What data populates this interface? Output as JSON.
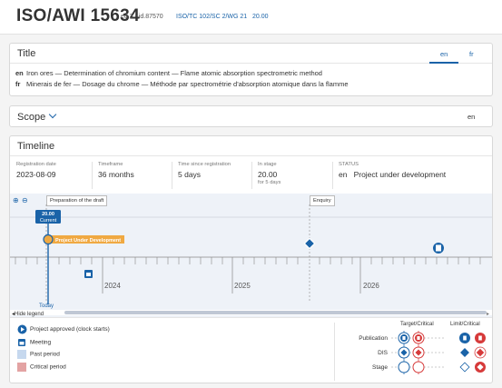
{
  "header": {
    "reference": "ISO/AWI 15634",
    "meta": "ed.3 - id.87570",
    "committee": "ISO/TC 102/SC 2/WG 21",
    "stage": "20.00"
  },
  "title_card": {
    "heading": "Title",
    "tabs": [
      "en",
      "fr"
    ],
    "active_tab": "en",
    "rows": [
      {
        "lang": "en",
        "text": "Iron ores — Determination of chromium content — Flame atomic absorption spectrometric method"
      },
      {
        "lang": "fr",
        "text": "Minerais de fer — Dosage du chrome — Méthode par spectrométrie d'absorption atomique dans la flamme"
      }
    ]
  },
  "scope_card": {
    "heading": "Scope",
    "language": "en"
  },
  "timeline": {
    "heading": "Timeline",
    "stats": [
      {
        "label": "Registration date",
        "value": "2023-08-09",
        "sub": ""
      },
      {
        "label": "Timeframe",
        "value": "36 months",
        "sub": ""
      },
      {
        "label": "Time since registration",
        "value": "5 days",
        "sub": ""
      },
      {
        "label": "In stage",
        "value": "20.00",
        "sub": "for 5 days"
      },
      {
        "label": "STATUS",
        "value": "Project under development",
        "sub": "",
        "lang": "en"
      }
    ],
    "zoom_in": "⊕",
    "zoom_out": "⊖",
    "phases": [
      "Preparation of the draft",
      "Enquiry"
    ],
    "current_stage": "20.00",
    "current_label": "Current",
    "bar_label": "Project Under Development",
    "years": [
      "2024",
      "2025",
      "2026"
    ],
    "today_label": "Today",
    "hide_legend": "Hide legend"
  },
  "legend": {
    "items": [
      {
        "label": "Project approved (clock starts)",
        "icon": "project-approved-icon"
      },
      {
        "label": "Meeting",
        "icon": "meeting-icon"
      },
      {
        "label": "Past period",
        "color": "#c6d8ee"
      },
      {
        "label": "Critical period",
        "color": "#e3a3a3"
      }
    ],
    "col_target": "Target/Critical",
    "col_limit": "Limit/Critical",
    "rows": [
      "Publication",
      "DIS",
      "Stage"
    ]
  },
  "colors": {
    "accent": "#1a63a8",
    "critical": "#d63a3a",
    "status_bar": "#f0a942",
    "past": "#c6d8ee",
    "critical_period": "#e3a3a3"
  }
}
